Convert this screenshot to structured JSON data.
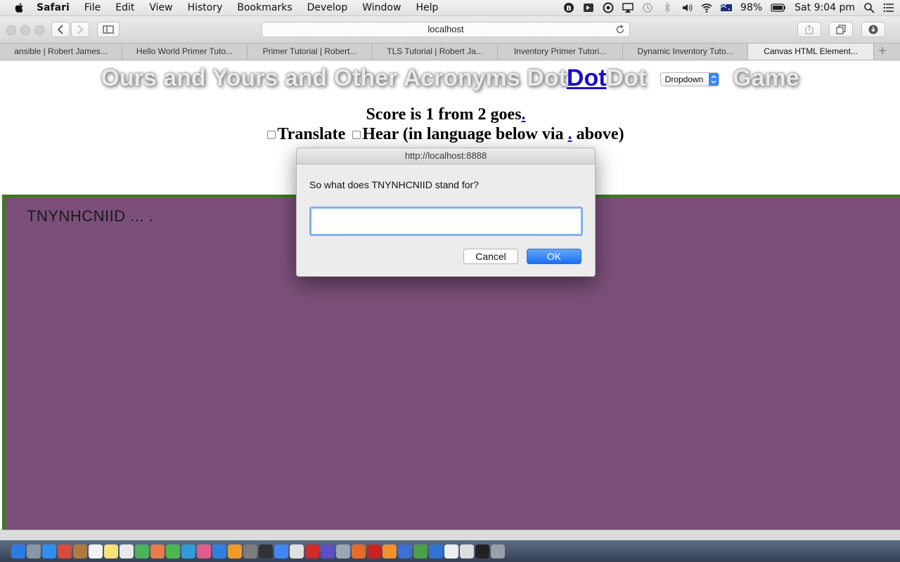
{
  "menubar": {
    "app_name": "Safari",
    "items": [
      "File",
      "Edit",
      "View",
      "History",
      "Bookmarks",
      "Develop",
      "Window",
      "Help"
    ],
    "battery": "98%",
    "clock": "Sat 9:04 pm"
  },
  "toolbar": {
    "url": "localhost"
  },
  "tabs": [
    {
      "label": "ansible | Robert James..."
    },
    {
      "label": "Hello World Primer Tuto..."
    },
    {
      "label": "Primer Tutorial | Robert..."
    },
    {
      "label": "TLS Tutorial | Robert Ja..."
    },
    {
      "label": "Inventory Primer Tutori..."
    },
    {
      "label": "Dynamic Inventory Tuto..."
    },
    {
      "label": "Canvas HTML Element..."
    }
  ],
  "page": {
    "heading_pre": "Ours and Yours and Other Acronyms Dot",
    "heading_link": "Dot",
    "heading_post": "Dot",
    "dropdown_value": "Dropdown",
    "heading_end": "Game",
    "score_text": "Score is 1 from 2 goes",
    "score_link": ".",
    "translate_label": "Translate",
    "hear_label": "Hear (in language below via",
    "hear_link": ".",
    "hear_end": "above)",
    "acronym_text": "TNYNHCNIID ... ."
  },
  "dialog": {
    "title": "http://localhost:8888",
    "prompt": "So what does TNYNHCNIID stand for?",
    "input_value": "",
    "cancel_label": "Cancel",
    "ok_label": "OK"
  },
  "colors": {
    "canvas_bg": "#7b4f79",
    "canvas_border": "#3d7a1c",
    "link": "#1a0dcc",
    "ok_button": "#1c6ff0"
  }
}
